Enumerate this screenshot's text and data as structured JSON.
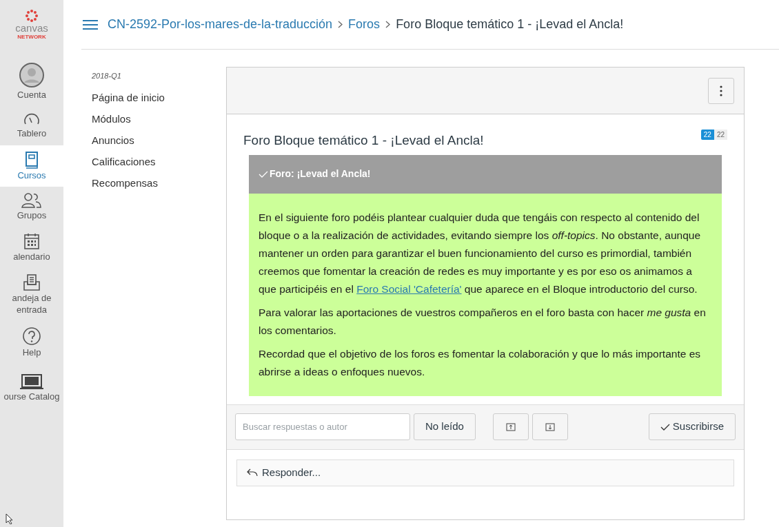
{
  "global_nav": {
    "logo": {
      "word": "canvas",
      "sub": "NETWORK"
    },
    "items": [
      {
        "kind": "account",
        "label": "Cuenta",
        "selected": false
      },
      {
        "kind": "dashboard",
        "label": "Tablero",
        "selected": false
      },
      {
        "kind": "courses",
        "label": "Cursos",
        "selected": true
      },
      {
        "kind": "groups",
        "label": "Grupos",
        "selected": false
      },
      {
        "kind": "calendar",
        "label": "alendario",
        "selected": false
      },
      {
        "kind": "inbox",
        "label": "andeja de entrada",
        "selected": false
      },
      {
        "kind": "help",
        "label": "Help",
        "selected": false
      },
      {
        "kind": "catalog",
        "label": "ourse Catalog",
        "selected": false
      }
    ]
  },
  "breadcrumb": [
    "CN-2592-Por-los-mares-de-la-traducción",
    "Foros",
    "Foro Bloque temático 1 - ¡Levad el Ancla!"
  ],
  "course_nav": {
    "term": "2018-Q1",
    "items": [
      "Página de inicio",
      "Módulos",
      "Anuncios",
      "Calificaciones",
      "Recompensas"
    ]
  },
  "topic": {
    "title": "Foro Bloque temático 1 - ¡Levad el Ancla!",
    "unread": "22",
    "total": "22",
    "banner": "Foro: ¡Levad el Ancla!",
    "paragraphs": [
      {
        "before": "En el siguiente foro podéis plantear cualquier duda que tengáis con respecto al contenido del bloque o a la realización de actividades, evitando siempre los *off-topics*. No obstante, aunque mantener un orden para garantizar el buen funcionamiento del curso es primordial, también creemos que fomentar la creación de redes es muy importante y es por eso os animamos a que participéis en el",
        "link": "Foro Social 'Cafetería'",
        "after": "que aparece en el Bloque introductorio del curso."
      },
      {
        "before": "Para valorar las aportaciones de vuestros compañeros en el foro basta con hacer *me gusta* en los comentarios."
      },
      {
        "before": "Recordad que el objetivo de los foros es fomentar la colaboración y que lo más importante es abrirse a ideas o enfoques nuevos."
      }
    ]
  },
  "toolbar": {
    "search_placeholder": "Buscar respuestas o autor",
    "unread_button": "No leído",
    "subscribe_button": "Suscribirse"
  },
  "reply": "Responder..."
}
